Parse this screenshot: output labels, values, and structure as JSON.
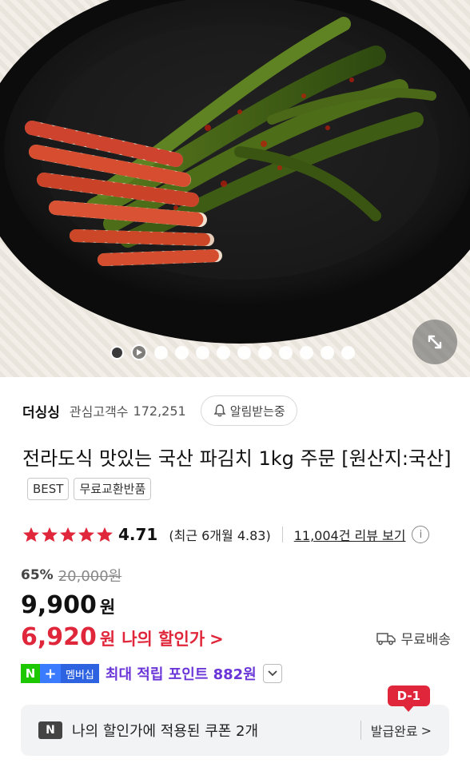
{
  "hero": {
    "image_name": "pa-kimchi-product-photo",
    "slide_count": 12,
    "active_slide": 1
  },
  "store": {
    "name": "더싱싱",
    "follower_label": "관심고객수",
    "follower_count": "172,251",
    "notify_label": "알림받는중"
  },
  "product": {
    "title": "전라도식 맛있는 국산 파김치 1kg 주문 [원산지:국산]",
    "tags": [
      "BEST",
      "무료교환반품"
    ]
  },
  "rating": {
    "value": "4.71",
    "stars": 5,
    "recent_text": "(최근 6개월 4.83)",
    "reviews_link": "11,004건 리뷰 보기",
    "info_icon": "i"
  },
  "price": {
    "discount_rate": "65%",
    "original": "20,000원",
    "sale": "9,900",
    "unit": "원",
    "my_price": "6,920",
    "my_price_unit": "원",
    "my_price_label": "나의 할인가",
    "my_price_chevron": ">",
    "shipping": "무료배송"
  },
  "points": {
    "badge_n": "N",
    "badge_plus": "+",
    "badge_member": "멤버십",
    "text": "최대 적립 포인트 882원"
  },
  "coupon": {
    "icon_label": "N",
    "text": "나의 할인가에 적용된 쿠폰 2개",
    "status": "발급완료",
    "status_chevron": ">",
    "d_badge": "D-1"
  },
  "colors": {
    "accent_red": "#e0263a",
    "points_purple": "#6b36d8",
    "naver_green": "#1ec800",
    "member_blue": "#2d63e0"
  }
}
